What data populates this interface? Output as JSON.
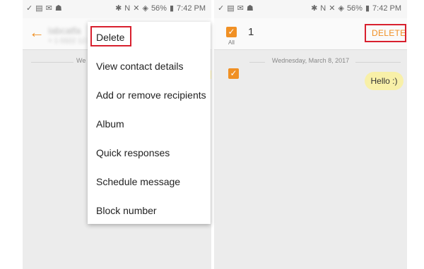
{
  "status_bar": {
    "left_icons": [
      "✓",
      "▤",
      "✉",
      "☗"
    ],
    "right_icons": [
      "✱",
      "N",
      "✕",
      "◈",
      "▮"
    ],
    "battery": "56%",
    "time": "7:42 PM"
  },
  "conversation": {
    "contact_name": "Iabcatfa",
    "contact_number": "+ 1 0322 12 3456",
    "date_fragment": "We"
  },
  "menu": {
    "items": [
      "Delete",
      "View contact details",
      "Add or remove recipients",
      "Album",
      "Quick responses",
      "Schedule message",
      "Block number"
    ]
  },
  "selection": {
    "check_glyph": "✓",
    "all_label": "All",
    "count": "1",
    "delete_label": "DELETE",
    "date": "Wednesday, March 8, 2017",
    "message": "Hello :)"
  },
  "colors": {
    "accent": "#f09024",
    "highlight": "#d8202e",
    "bubble": "#f8f0a8"
  }
}
